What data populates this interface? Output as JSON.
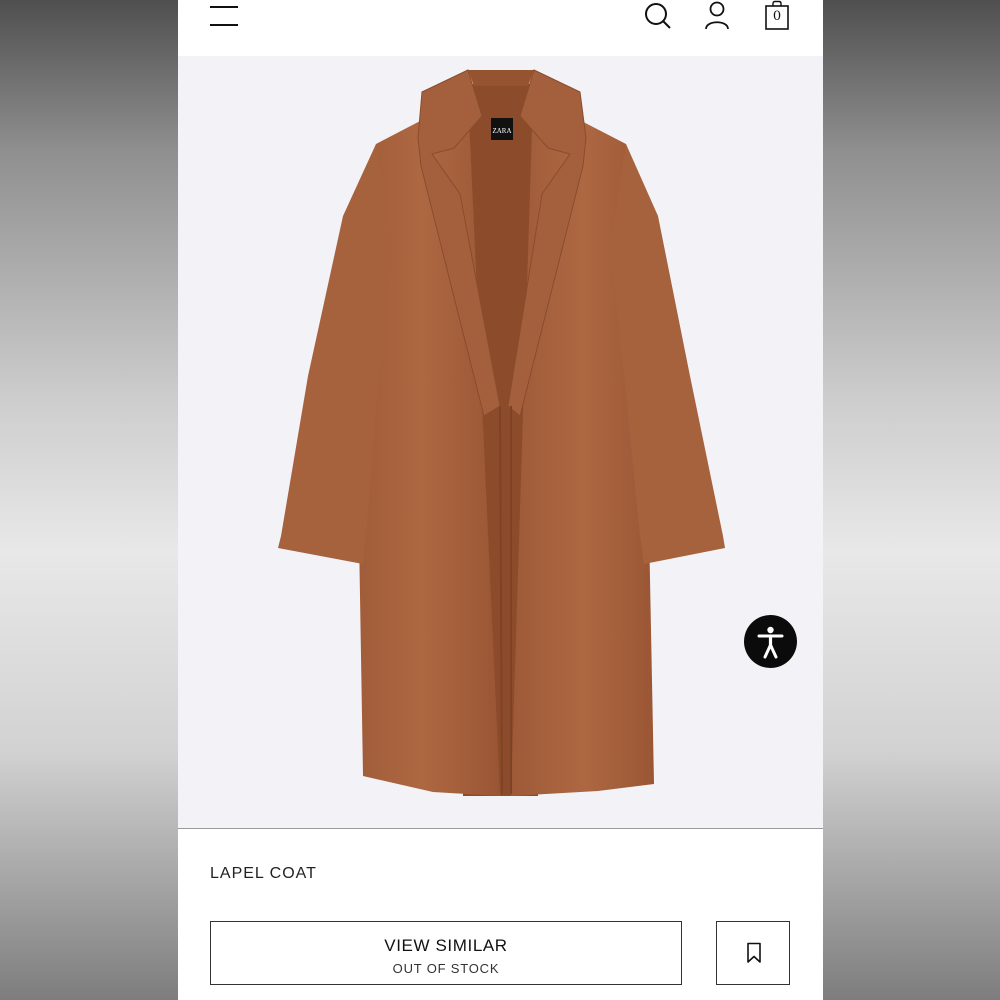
{
  "header": {
    "menu_icon": "hamburger-menu-icon",
    "search_icon": "search-icon",
    "account_icon": "user-account-icon",
    "bag_icon": "shopping-bag-icon",
    "bag_count": "0"
  },
  "product": {
    "image": "brown-coat-product-image",
    "label_text": "ZARA",
    "name": "LAPEL COAT",
    "coat_color": "#a9633f"
  },
  "actions": {
    "view_similar_label": "VIEW SIMILAR",
    "stock_status": "OUT OF STOCK",
    "wishlist_icon": "bookmark-icon"
  },
  "accessibility": {
    "icon": "accessibility-icon"
  }
}
